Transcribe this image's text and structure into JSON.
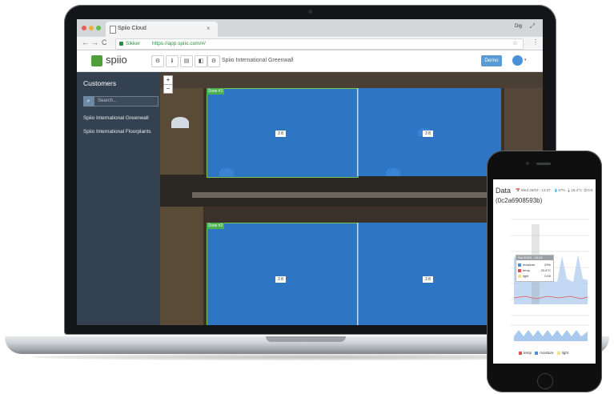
{
  "browser": {
    "tab_title": "Spiio Cloud",
    "tab_close": "×",
    "user_chip": "Dig",
    "window_controls": "⤢",
    "back": "←",
    "forward": "→",
    "reload": "C",
    "secure_label": "Sikker",
    "url": "https://app.spiio.com/#/",
    "bookmark": "☆",
    "menu": "⋮"
  },
  "header": {
    "logo_text": "spiio",
    "toolbar_icons": [
      "⚙",
      "ℹ",
      "▤",
      "◧",
      "⚙"
    ],
    "project_title": "Spiio International Greenwall",
    "demo_label": "Demo",
    "avatar_caret": "▾"
  },
  "sidebar": {
    "title": "Customers",
    "search_icon": "🔍",
    "search_placeholder": "Search...",
    "items": [
      {
        "label": "Spiio International Greenwall"
      },
      {
        "label": "Spiio International Floorplants"
      }
    ]
  },
  "map": {
    "zoom_in": "+",
    "zoom_out": "−",
    "zones": [
      {
        "tag": "Zone #1",
        "values": [
          "3 8",
          "3 8"
        ]
      },
      {
        "tag": "Zone #2",
        "values": [
          "3 8",
          "3 8"
        ]
      }
    ]
  },
  "phone": {
    "title": "Data",
    "meta": "📅 Wed 25/03 - 13:37 · 💧57% 🌡18.4°C ☀0.0",
    "device_id": "(0c2a6908593b)",
    "tooltip": {
      "header": "Sat 30/03 - 00:24",
      "rows": [
        {
          "label": "moisture",
          "value": "29%",
          "color": "#4a90d9"
        },
        {
          "label": "temp",
          "value": "20.8°C",
          "color": "#e05252"
        },
        {
          "label": "light",
          "value": "0.00",
          "color": "#f0e28a"
        }
      ]
    },
    "legend": [
      "temp",
      "moisture",
      "light"
    ],
    "legend_colors": [
      "#e05252",
      "#4a90d9",
      "#f0e28a"
    ]
  },
  "colors": {
    "sidebar": "#344150",
    "accent_green": "#4e9e3c",
    "zone_blue": "#2e7bd1",
    "demo_button": "#5b9bd5"
  }
}
